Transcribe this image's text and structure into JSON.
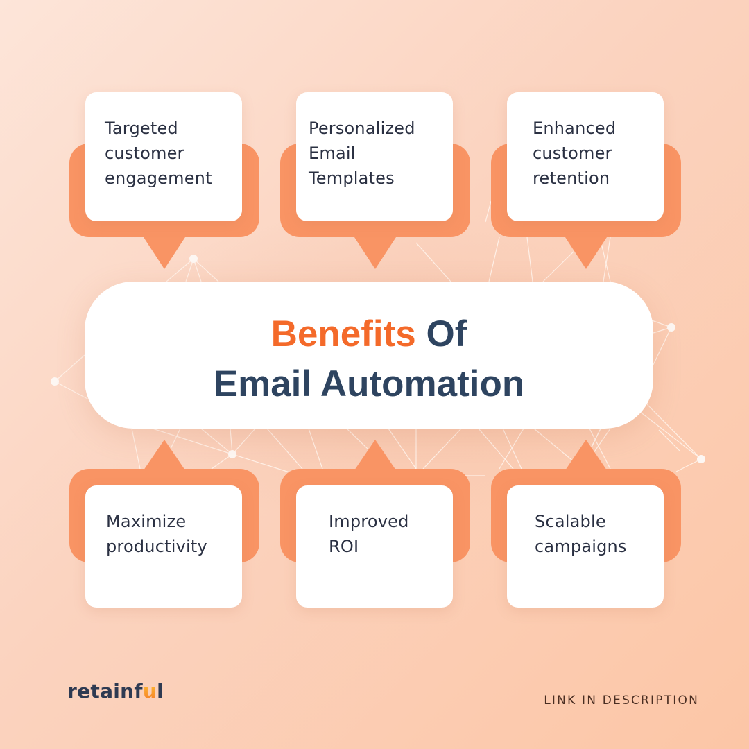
{
  "colors": {
    "accent_orange": "#f46a2a",
    "frame_orange": "#f99464",
    "heading_navy": "#2e4460",
    "body_text": "#2a3042",
    "panel_white": "#ffffff",
    "background_light": "#fde5d9",
    "background_dark": "#fcc6a6",
    "footer_text": "#4a2e22"
  },
  "hero": {
    "title_accent": "Benefits",
    "title_rest_line1": " Of",
    "title_line2": "Email Automation"
  },
  "benefits_top": [
    {
      "label": "Targeted\ncustomer\nengagement"
    },
    {
      "label": "Personalized\nEmail\nTemplates"
    },
    {
      "label": "Enhanced\ncustomer\nretention"
    }
  ],
  "benefits_bottom": [
    {
      "label": "Maximize\nproductivity"
    },
    {
      "label": "Improved\nROI"
    },
    {
      "label": "Scalable\ncampaigns"
    }
  ],
  "brand": {
    "logo_prefix": "retainf",
    "logo_highlight": "u",
    "logo_suffix": "l"
  },
  "footer": {
    "cta": "LINK IN DESCRIPTION"
  }
}
